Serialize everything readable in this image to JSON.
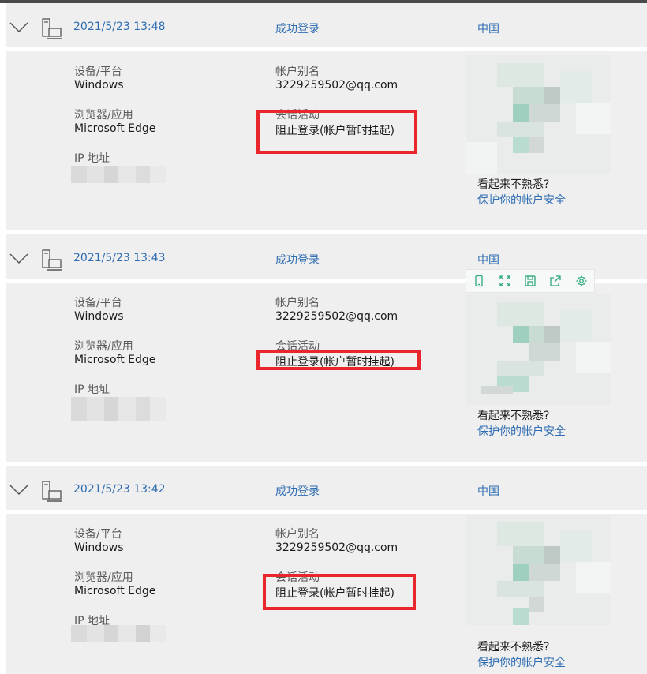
{
  "entries": [
    {
      "date": "2021/5/23 13:48",
      "status": "成功登录",
      "country": "中国",
      "device_label": "设备/平台",
      "device_value": "Windows",
      "browser_label": "浏览器/应用",
      "browser_value": "Microsoft Edge",
      "ip_label": "IP 地址",
      "alias_label": "帐户别名",
      "alias_value": "3229259502@qq.com",
      "session_label": "会话活动",
      "session_value": "阻止登录(帐户暂时挂起)",
      "unfamiliar": "看起来不熟悉?",
      "secure_link": "保护你的帐户安全"
    },
    {
      "date": "2021/5/23 13:43",
      "status": "成功登录",
      "country": "中国",
      "device_label": "设备/平台",
      "device_value": "Windows",
      "browser_label": "浏览器/应用",
      "browser_value": "Microsoft Edge",
      "ip_label": "IP 地址",
      "alias_label": "帐户别名",
      "alias_value": "3229259502@qq.com",
      "session_label": "会话活动",
      "session_value": "阻止登录(帐户暂时挂起)",
      "unfamiliar": "看起来不熟悉?",
      "secure_link": "保护你的帐户安全"
    },
    {
      "date": "2021/5/23 13:42",
      "status": "成功登录",
      "country": "中国",
      "device_label": "设备/平台",
      "device_value": "Windows",
      "browser_label": "浏览器/应用",
      "browser_value": "Microsoft Edge",
      "ip_label": "IP 地址",
      "alias_label": "帐户别名",
      "alias_value": "3229259502@qq.com",
      "session_label": "会话活动",
      "session_value": "阻止登录(帐户暂时挂起)",
      "unfamiliar": "看起来不熟悉?",
      "secure_link": "保护你的帐户安全"
    }
  ],
  "icons": {
    "expand": "chevron-down-icon",
    "device": "computer-device-icon",
    "toolbar": [
      "phone-icon",
      "expand-icon",
      "save-icon",
      "share-icon",
      "gear-icon"
    ]
  },
  "colors": {
    "link": "#2f6db2",
    "highlight": "#e8262b",
    "panel": "#efefef",
    "toolbar_icon": "#2aa877"
  }
}
